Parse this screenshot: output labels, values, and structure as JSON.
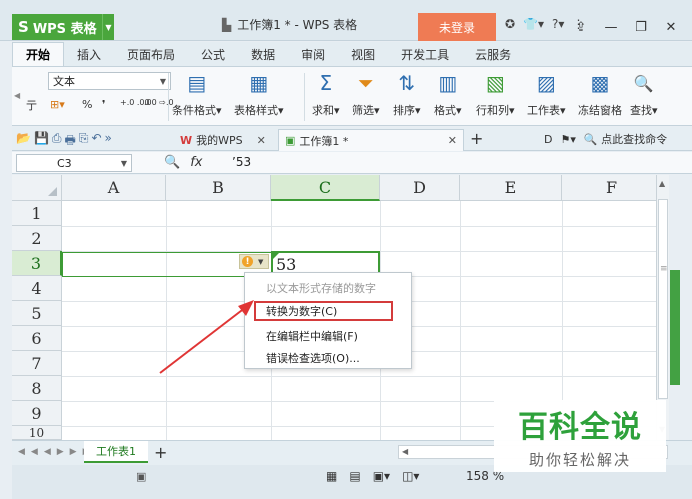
{
  "app": {
    "name": "WPS 表格",
    "logo": "S",
    "doc_title": "工作簿1 * - WPS 表格",
    "login": "未登录",
    "icons": [
      "✪",
      "👕▾",
      "?▾",
      "⋮"
    ],
    "win_controls": [
      "⇪",
      "—",
      "❐",
      "✕"
    ]
  },
  "menu": {
    "tabs": [
      "开始",
      "插入",
      "页面布局",
      "公式",
      "数据",
      "审阅",
      "视图",
      "开发工具",
      "云服务"
    ]
  },
  "ribbon": {
    "left_char": "亍",
    "number_format": "文本",
    "num_buttons": [
      "⊞▾",
      "%",
      "❜",
      "+.0 .00",
      ".00 ⇨.0"
    ],
    "groups": [
      {
        "label": "条件格式▾",
        "icon": "▤"
      },
      {
        "label": "表格样式▾",
        "icon": "▦"
      },
      {
        "label": "求和▾",
        "icon": "Σ"
      },
      {
        "label": "筛选▾",
        "icon": "⏷"
      },
      {
        "label": "排序▾",
        "icon": "⇅"
      },
      {
        "label": "格式▾",
        "icon": "▥"
      },
      {
        "label": "行和列▾",
        "icon": "▧"
      },
      {
        "label": "工作表▾",
        "icon": "▨"
      },
      {
        "label": "冻结窗格",
        "icon": "▩"
      },
      {
        "label": "查找▾",
        "icon": "🔍"
      }
    ]
  },
  "tabstrip": {
    "quick_icons": [
      "📂",
      "💾",
      "⎙",
      "🖶",
      "⎘",
      "↶",
      "»"
    ],
    "tabs": [
      {
        "label": "我的WPS",
        "icon": "W",
        "close": "✕"
      },
      {
        "label": "工作簿1 *",
        "icon": "▣",
        "close": "✕"
      }
    ],
    "add": "+",
    "right_items": [
      "D",
      "⚑▾",
      "🔍 点此查找命令"
    ]
  },
  "formula_bar": {
    "cell_ref": "C3",
    "zoom_icon": "🔍",
    "fx": "fx",
    "value": "’53"
  },
  "grid": {
    "columns": [
      "A",
      "B",
      "C",
      "D",
      "E",
      "F"
    ],
    "rows": [
      "1",
      "2",
      "3",
      "4",
      "5",
      "6",
      "7",
      "8",
      "9",
      "10"
    ],
    "active_cell_value": "53",
    "error_icon": "!"
  },
  "popup": {
    "hint": "以文本形式存储的数字",
    "items": [
      "转换为数字(C)",
      "在编辑栏中编辑(F)",
      "错误检查选项(O)..."
    ]
  },
  "sheetbar": {
    "nav": "◀◀◀▶▶▶",
    "sheet": "工作表1",
    "add": "+"
  },
  "statusbar": {
    "views": [
      "▦",
      "▤",
      "▣▾",
      "◫▾"
    ],
    "zoom": "158 %"
  },
  "watermark": {
    "title": "百科全说",
    "subtitle": "助你轻松解决"
  },
  "colors": {
    "accent_green": "#3d9b35",
    "login_orange": "#ef7b54",
    "error_red": "#d43b3b",
    "arrow_red": "#e03535"
  }
}
